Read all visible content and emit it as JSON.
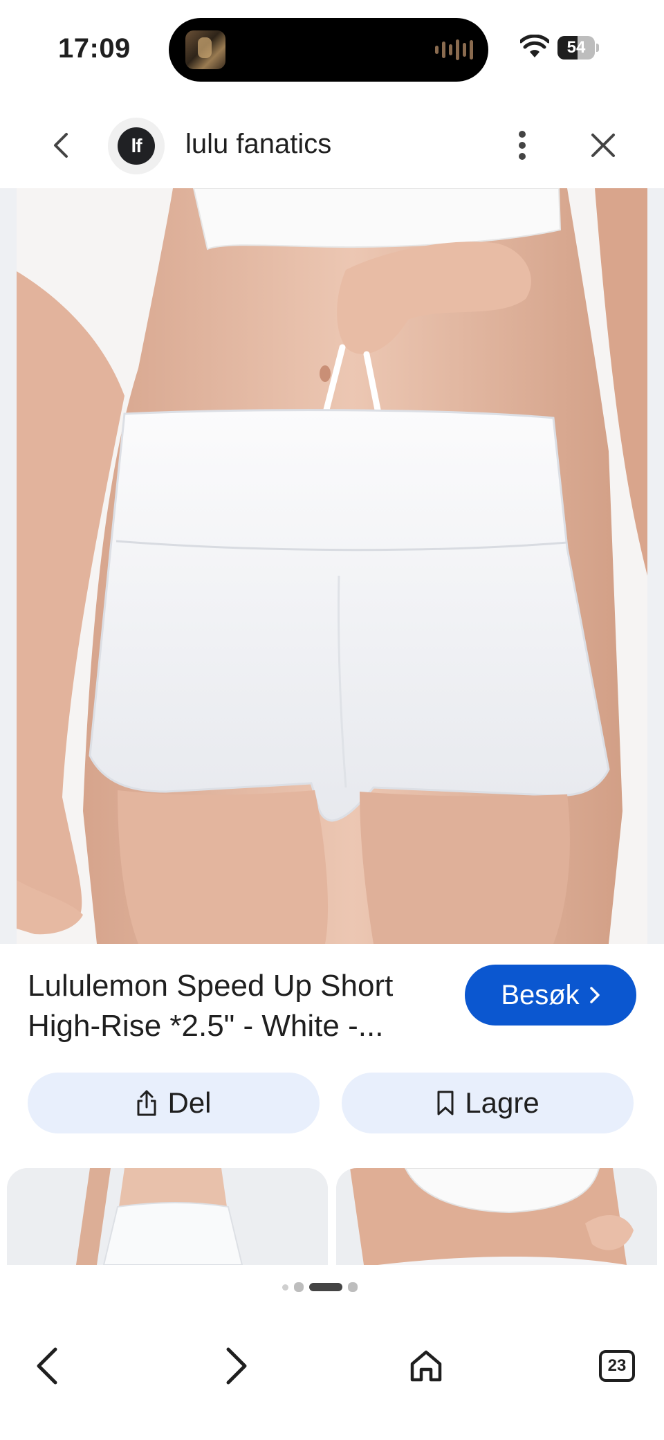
{
  "status_bar": {
    "time": "17:09",
    "battery_level": "54",
    "battery_fraction": 0.54
  },
  "header": {
    "site_logo_text": "lf",
    "site_name": "lulu fanatics"
  },
  "product": {
    "title_line1": "Lululemon Speed Up Short",
    "title_line2": "High-Rise *2.5\" - White -..."
  },
  "buttons": {
    "visit_label": "Besøk",
    "share_label": "Del",
    "save_label": "Lagre"
  },
  "carousel": {
    "page_count": 4,
    "active_index": 2
  },
  "bottom_nav": {
    "tabs_count": "23"
  },
  "colors": {
    "accent": "#0b57d0",
    "action_bg": "#e8effc",
    "text": "#1f1f1f"
  },
  "icons": {
    "back": "chevron-left-icon",
    "more": "more-vert-icon",
    "close": "close-icon",
    "visit_chevron": "chevron-right-icon",
    "share": "share-icon",
    "save": "bookmark-icon",
    "nav_back": "arrow-back-icon",
    "nav_forward": "arrow-forward-icon",
    "home": "home-icon",
    "tabs": "tabs-icon"
  }
}
